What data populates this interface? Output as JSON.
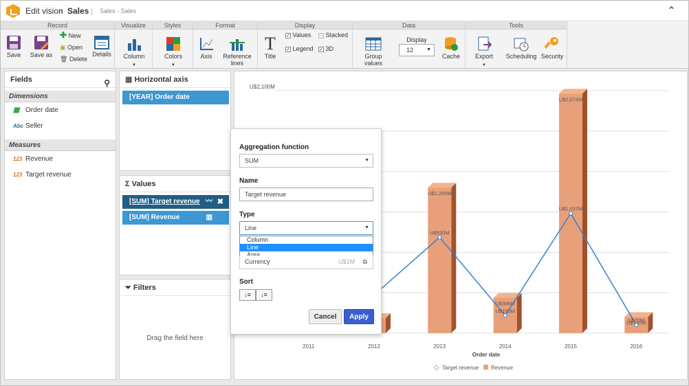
{
  "titlebar": {
    "app": "Edit vision",
    "arrow": "›",
    "page": "Sales",
    "sep": "|",
    "sub": "Sales - Sales",
    "collapse": "⌃"
  },
  "ribbon": {
    "groups": [
      "Record",
      "Visualize",
      "Styles",
      "Format",
      "Display",
      "Data",
      "Tools"
    ],
    "save": "Save",
    "save_as": "Save as",
    "new": "New",
    "open": "Open",
    "delete": "Delete",
    "details": "Details",
    "column": "Column",
    "colors": "Colors",
    "axis": "Axis",
    "reference_lines_1": "Reference",
    "reference_lines_2": "lines",
    "title_btn": "Title",
    "values": "Values",
    "legend": "Legend",
    "stacked": "Stacked",
    "three_d": "3D",
    "group_values": "Group values",
    "display_label": "Display",
    "display_value": "12",
    "cache": "Cache",
    "export": "Export",
    "scheduling": "Scheduling",
    "security": "Security",
    "checks": {
      "values": true,
      "legend": true,
      "stacked": false,
      "three_d": true
    }
  },
  "fields": {
    "title": "Fields",
    "dimensions": "Dimensions",
    "dim_items": [
      {
        "tag": "",
        "label": "Order date"
      },
      {
        "tag": "Abc",
        "label": "Seller"
      }
    ],
    "measures": "Measures",
    "measure_items": [
      {
        "tag": "123",
        "label": "Revenue"
      },
      {
        "tag": "123",
        "label": "Target revenue"
      }
    ]
  },
  "haxis": {
    "title": "Horizontal axis",
    "chip": "[YEAR] Order date"
  },
  "values": {
    "sigma": "Σ",
    "title": "Values",
    "chip1": "[SUM] Target revenue",
    "chip2": "[SUM] Revenue"
  },
  "filters": {
    "title": "Filters",
    "placeholder": "Drag the field here"
  },
  "dialog": {
    "agg_label": "Aggregation function",
    "agg_value": "SUM",
    "name_label": "Name",
    "name_value": "Target revenue",
    "type_label": "Type",
    "type_value": "Line",
    "type_options": [
      "Column",
      "Line",
      "Area"
    ],
    "format_value": "Currency",
    "format_preview": "U$1M",
    "sort_label": "Sort",
    "cancel": "Cancel",
    "apply": "Apply"
  },
  "chart_data": {
    "type": "bar",
    "categories": [
      "2011",
      "2012",
      "2013",
      "2014",
      "2015",
      "2016"
    ],
    "series": [
      {
        "name": "Revenue",
        "type": "bar",
        "values": [
          10,
          130,
          1260,
          306,
          2074,
          140
        ],
        "labels": [
          "",
          "",
          "U$1,260M",
          "U$306M",
          "U$2,074M",
          "U$140M"
        ]
      },
      {
        "name": "Target revenue",
        "type": "line",
        "values": [
          null,
          330,
          830,
          153,
          1037,
          70
        ],
        "labels": [
          "",
          "",
          "U$830M",
          "U$153M",
          "U$1,037M",
          "U$70M"
        ]
      }
    ],
    "xlabel": "Order date",
    "ylabel": "",
    "ylim": [
      0,
      2100
    ],
    "ytick_label": "U$2,100M",
    "grid": true,
    "legend": "bottom-center"
  }
}
